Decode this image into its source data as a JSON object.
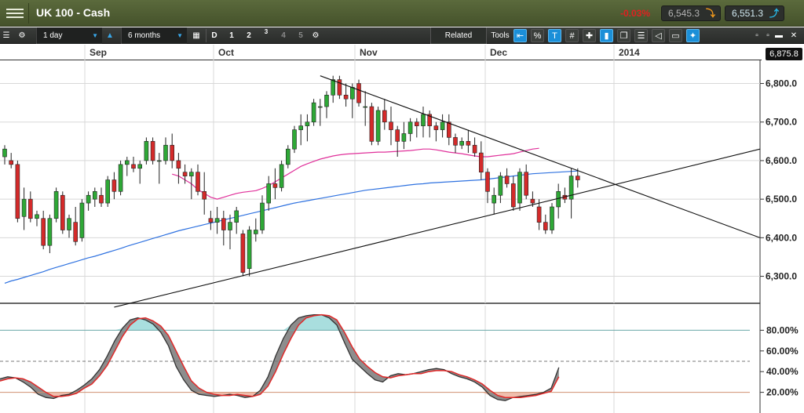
{
  "titlebar": {
    "title": "UK 100 - Cash",
    "change": "-0.03%",
    "sell_price": "6,545.3",
    "buy_price": "6,551.3",
    "sell_icon": "arrow-down-icon",
    "buy_icon": "arrow-up-icon"
  },
  "toolbar": {
    "interval": "1 day",
    "range": "6 months",
    "chart_types": [
      "D",
      "1",
      "2",
      "3",
      "4",
      "5"
    ],
    "related_label": "Related",
    "tools_label": "Tools"
  },
  "colors": {
    "up_candle": "#2ea836",
    "down_candle": "#d42a2a",
    "ma_short": "#e0309a",
    "ma_long": "#2f72e0",
    "stoch_k": "#333333",
    "stoch_d": "#e02828",
    "overbought_fill": "#a9dede",
    "oversold_fill": "#f0bfae"
  },
  "chart_data": {
    "type": "candlestick",
    "time_labels": [
      "Sep",
      "Oct",
      "Nov",
      "Dec",
      "2014"
    ],
    "last_price_label": "6,875.8",
    "price_axis": [
      "6,800.0",
      "6,700.0",
      "6,600.0",
      "6,500.0",
      "6,400.0",
      "6,300.0"
    ],
    "ylim": [
      6230,
      6860
    ],
    "candles": [
      [
        6610,
        6640,
        6590,
        6630
      ],
      [
        6600,
        6620,
        6580,
        6590
      ],
      [
        6590,
        6600,
        6440,
        6450
      ],
      [
        6455,
        6530,
        6420,
        6500
      ],
      [
        6500,
        6520,
        6440,
        6450
      ],
      [
        6450,
        6470,
        6430,
        6460
      ],
      [
        6450,
        6470,
        6370,
        6380
      ],
      [
        6380,
        6460,
        6360,
        6450
      ],
      [
        6450,
        6530,
        6440,
        6520
      ],
      [
        6510,
        6520,
        6410,
        6420
      ],
      [
        6420,
        6460,
        6400,
        6450
      ],
      [
        6440,
        6480,
        6380,
        6390
      ],
      [
        6400,
        6500,
        6390,
        6490
      ],
      [
        6490,
        6520,
        6470,
        6510
      ],
      [
        6500,
        6530,
        6480,
        6520
      ],
      [
        6510,
        6530,
        6480,
        6490
      ],
      [
        6490,
        6560,
        6480,
        6550
      ],
      [
        6550,
        6570,
        6500,
        6520
      ],
      [
        6520,
        6600,
        6510,
        6590
      ],
      [
        6590,
        6610,
        6560,
        6600
      ],
      [
        6590,
        6610,
        6570,
        6580
      ],
      [
        6580,
        6600,
        6540,
        6590
      ],
      [
        6600,
        6660,
        6590,
        6650
      ],
      [
        6650,
        6660,
        6590,
        6600
      ],
      [
        6600,
        6620,
        6540,
        6600
      ],
      [
        6600,
        6660,
        6590,
        6640
      ],
      [
        6640,
        6670,
        6580,
        6600
      ],
      [
        6600,
        6620,
        6540,
        6580
      ],
      [
        6570,
        6590,
        6540,
        6560
      ],
      [
        6560,
        6580,
        6500,
        6570
      ],
      [
        6570,
        6590,
        6510,
        6520
      ],
      [
        6520,
        6570,
        6460,
        6500
      ],
      [
        6450,
        6470,
        6420,
        6440
      ],
      [
        6440,
        6480,
        6410,
        6450
      ],
      [
        6450,
        6470,
        6380,
        6420
      ],
      [
        6420,
        6460,
        6370,
        6440
      ],
      [
        6440,
        6480,
        6410,
        6470
      ],
      [
        6410,
        6420,
        6300,
        6310
      ],
      [
        6320,
        6430,
        6300,
        6420
      ],
      [
        6410,
        6450,
        6390,
        6420
      ],
      [
        6420,
        6510,
        6410,
        6490
      ],
      [
        6490,
        6560,
        6470,
        6540
      ],
      [
        6540,
        6580,
        6500,
        6530
      ],
      [
        6530,
        6600,
        6520,
        6590
      ],
      [
        6590,
        6640,
        6580,
        6630
      ],
      [
        6630,
        6690,
        6620,
        6680
      ],
      [
        6680,
        6720,
        6640,
        6690
      ],
      [
        6690,
        6720,
        6650,
        6700
      ],
      [
        6700,
        6760,
        6690,
        6750
      ],
      [
        6740,
        6760,
        6690,
        6740
      ],
      [
        6740,
        6780,
        6710,
        6770
      ],
      [
        6770,
        6820,
        6750,
        6810
      ],
      [
        6810,
        6820,
        6760,
        6770
      ],
      [
        6770,
        6800,
        6740,
        6760
      ],
      [
        6760,
        6800,
        6710,
        6790
      ],
      [
        6800,
        6810,
        6740,
        6750
      ],
      [
        6740,
        6780,
        6690,
        6740
      ],
      [
        6740,
        6750,
        6640,
        6650
      ],
      [
        6650,
        6740,
        6640,
        6730
      ],
      [
        6730,
        6760,
        6680,
        6700
      ],
      [
        6700,
        6740,
        6640,
        6680
      ],
      [
        6680,
        6690,
        6610,
        6650
      ],
      [
        6650,
        6700,
        6630,
        6670
      ],
      [
        6670,
        6710,
        6650,
        6700
      ],
      [
        6700,
        6710,
        6660,
        6690
      ],
      [
        6690,
        6740,
        6660,
        6720
      ],
      [
        6720,
        6730,
        6660,
        6690
      ],
      [
        6690,
        6700,
        6650,
        6680
      ],
      [
        6680,
        6720,
        6660,
        6700
      ],
      [
        6700,
        6720,
        6640,
        6660
      ],
      [
        6660,
        6670,
        6620,
        6640
      ],
      [
        6640,
        6660,
        6630,
        6650
      ],
      [
        6650,
        6680,
        6620,
        6640
      ],
      [
        6640,
        6660,
        6610,
        6620
      ],
      [
        6620,
        6650,
        6550,
        6570
      ],
      [
        6570,
        6580,
        6490,
        6520
      ],
      [
        6490,
        6530,
        6460,
        6510
      ],
      [
        6510,
        6570,
        6490,
        6560
      ],
      [
        6560,
        6580,
        6530,
        6540
      ],
      [
        6540,
        6560,
        6470,
        6480
      ],
      [
        6490,
        6580,
        6470,
        6570
      ],
      [
        6570,
        6590,
        6500,
        6510
      ],
      [
        6500,
        6520,
        6480,
        6490
      ],
      [
        6480,
        6500,
        6420,
        6440
      ],
      [
        6440,
        6460,
        6410,
        6420
      ],
      [
        6420,
        6490,
        6410,
        6480
      ],
      [
        6480,
        6540,
        6450,
        6520
      ],
      [
        6510,
        6530,
        6490,
        6500
      ],
      [
        6500,
        6580,
        6450,
        6560
      ],
      [
        6560,
        6580,
        6530,
        6550
      ]
    ],
    "ma_short": {
      "start_index": 26,
      "values": [
        6565,
        6560,
        6550,
        6540,
        6525,
        6515,
        6505,
        6500,
        6505,
        6510,
        6515,
        6518,
        6520,
        6522,
        6528,
        6535,
        6545,
        6555,
        6565,
        6575,
        6585,
        6592,
        6598,
        6604,
        6608,
        6612,
        6615,
        6617,
        6618,
        6619,
        6620,
        6621,
        6622,
        6622,
        6623,
        6624,
        6625,
        6626,
        6628,
        6630,
        6630,
        6628,
        6625,
        6622,
        6620,
        6618,
        6615,
        6612,
        6610,
        6610,
        6612,
        6614,
        6616,
        6618,
        6622,
        6626,
        6630,
        6632
      ]
    },
    "ma_long": [
      6282,
      6288,
      6292,
      6297,
      6302,
      6307,
      6312,
      6318,
      6323,
      6328,
      6333,
      6338,
      6343,
      6348,
      6352,
      6357,
      6362,
      6367,
      6372,
      6378,
      6383,
      6388,
      6393,
      6398,
      6403,
      6408,
      6413,
      6418,
      6422,
      6426,
      6430,
      6434,
      6438,
      6442,
      6446,
      6450,
      6454,
      6458,
      6462,
      6466,
      6470,
      6474,
      6478,
      6482,
      6486,
      6490,
      6493,
      6496,
      6499,
      6502,
      6505,
      6508,
      6511,
      6514,
      6517,
      6520,
      6523,
      6525,
      6527,
      6529,
      6531,
      6533,
      6535,
      6537,
      6539,
      6540,
      6542,
      6543,
      6544,
      6545,
      6546,
      6547,
      6548,
      6549,
      6550,
      6552,
      6554,
      6556,
      6558,
      6560,
      6562,
      6564,
      6566,
      6567,
      6568,
      6569,
      6570,
      6571,
      6572,
      6573
    ],
    "trendlines": [
      {
        "from": [
          49,
          6820
        ],
        "to": [
          -1,
          6400
        ]
      },
      {
        "from": [
          17,
          6220
        ],
        "to": [
          -1,
          6630
        ]
      }
    ],
    "stochastic": {
      "ylim": [
        0,
        100
      ],
      "axis_labels": [
        "80.00%",
        "60.00%",
        "40.00%",
        "20.00%"
      ],
      "overbought": 80,
      "oversold": 20,
      "midline": 50,
      "k": [
        33,
        35,
        34,
        30,
        25,
        18,
        15,
        14,
        17,
        18,
        22,
        27,
        33,
        42,
        55,
        70,
        82,
        90,
        92,
        90,
        86,
        78,
        65,
        45,
        32,
        22,
        18,
        17,
        16,
        17,
        18,
        17,
        15,
        16,
        22,
        35,
        55,
        72,
        85,
        92,
        94,
        95,
        95,
        92,
        85,
        68,
        52,
        45,
        38,
        32,
        30,
        36,
        38,
        37,
        38,
        40,
        42,
        43,
        42,
        38,
        35,
        33,
        30,
        25,
        17,
        13,
        12,
        15,
        16,
        17,
        18,
        20,
        24,
        44
      ],
      "d": [
        31,
        33,
        34,
        33,
        30,
        25,
        20,
        16,
        16,
        17,
        19,
        24,
        28,
        36,
        46,
        60,
        74,
        85,
        91,
        92,
        89,
        84,
        75,
        60,
        45,
        31,
        24,
        20,
        18,
        17,
        17,
        18,
        17,
        16,
        18,
        26,
        40,
        57,
        72,
        85,
        92,
        94,
        95,
        94,
        90,
        78,
        64,
        52,
        45,
        39,
        35,
        34,
        36,
        37,
        38,
        38,
        40,
        41,
        41,
        40,
        37,
        35,
        32,
        28,
        22,
        17,
        15,
        15,
        15,
        16,
        17,
        19,
        21,
        35
      ]
    }
  }
}
